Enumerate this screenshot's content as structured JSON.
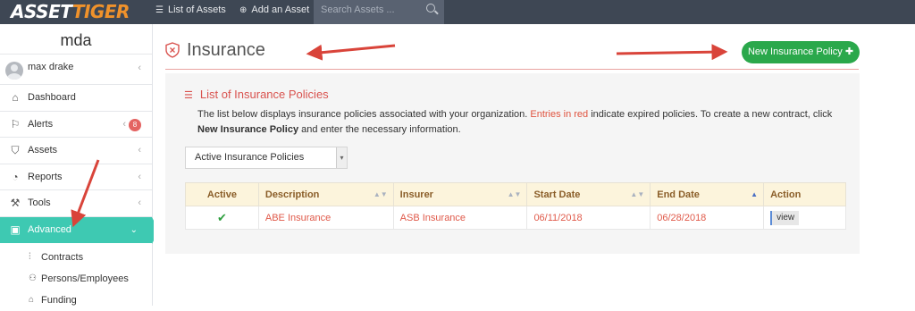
{
  "topbar": {
    "logo_part1": "ASSET",
    "logo_part2": "TIGER",
    "nav_list": "List of Assets",
    "nav_add": "Add an Asset",
    "search_placeholder": "Search Assets ..."
  },
  "sidebar": {
    "org_name": "mda",
    "user_name": "max drake",
    "items": [
      {
        "label": "Dashboard",
        "icon": "home-icon"
      },
      {
        "label": "Alerts",
        "icon": "flag-icon",
        "badge": "8"
      },
      {
        "label": "Assets",
        "icon": "tag-icon"
      },
      {
        "label": "Reports",
        "icon": "gauge-icon"
      },
      {
        "label": "Tools",
        "icon": "wrench-icon"
      },
      {
        "label": "Advanced",
        "icon": "briefcase-icon"
      }
    ],
    "subitems": [
      {
        "label": "Contracts",
        "icon": "sliders-icon"
      },
      {
        "label": "Persons/Employees",
        "icon": "users-icon"
      },
      {
        "label": "Funding",
        "icon": "bank-icon"
      }
    ]
  },
  "page": {
    "title": "Insurance",
    "new_button": "New Insurance Policy",
    "section_title": "List of Insurance Policies",
    "desc_part1": "The list below displays insurance policies associated with your organization. ",
    "desc_red": "Entries in red",
    "desc_part2": " indicate expired policies. To create a new contract, click ",
    "desc_bold": "New Insurance Policy",
    "desc_part3": " and enter the necessary information.",
    "filter_value": "Active Insurance Policies"
  },
  "table": {
    "headers": [
      "Active",
      "Description",
      "Insurer",
      "Start Date",
      "End Date",
      "Action"
    ],
    "rows": [
      {
        "active": "✔",
        "description": "ABE Insurance",
        "insurer": "ASB Insurance",
        "start": "06/11/2018",
        "end": "06/28/2018",
        "action": "view"
      }
    ]
  },
  "colors": {
    "topbar": "#3e4754",
    "accent_teal": "#3ec9b2",
    "button_green": "#2aa84b",
    "annotation_red": "#d9443a",
    "expired_red": "#e05a4a"
  }
}
